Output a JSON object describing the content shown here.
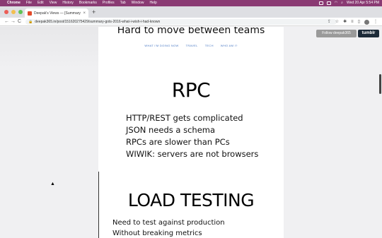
{
  "menubar": {
    "apple": "",
    "items": [
      "Chrome",
      "File",
      "Edit",
      "View",
      "History",
      "Bookmarks",
      "Profiles",
      "Tab",
      "Window",
      "Help"
    ],
    "clock": "Wed 20 Apr 5:54 PM"
  },
  "tab": {
    "title": "Deepak's Views — [Summary]",
    "close": "×",
    "new_tab": "+"
  },
  "toolbar": {
    "back": "←",
    "forward": "→",
    "reload": "C",
    "lock": "🔒",
    "url": "deepak365.in/post/151620275429/summary-gots-2016-what-i-wish-i-had-known"
  },
  "page": {
    "previous_title": "Hard to move between teams",
    "nav_links": [
      "WHAT I'M DOING NOW",
      "TRAVEL",
      "TECH",
      "WHO AM I?"
    ],
    "slide1_title": "RPC",
    "slide1_bullets": [
      "HTTP/REST gets complicated",
      "JSON needs a schema",
      "RPCs are slower than PCs",
      "WIWIK: servers are not browsers"
    ],
    "slide2_title": "LOAD TESTING",
    "slide2_lines": [
      "Need to test against production",
      "Without breaking metrics"
    ],
    "follow_button": "Follow deepak365",
    "tumblr_logo": "tumblr"
  },
  "colors": {
    "menubar": "#8a3a73",
    "link": "#4a79c4",
    "tumblr": "#1c2a38"
  }
}
